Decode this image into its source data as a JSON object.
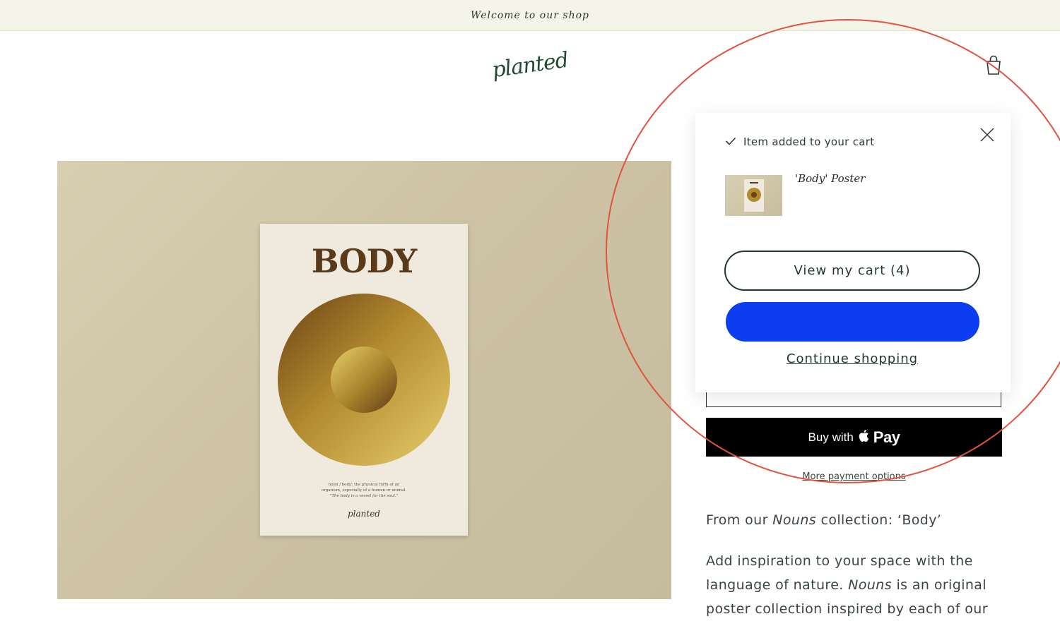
{
  "announcement": {
    "text": "Welcome to our shop"
  },
  "header": {
    "logo_text": "planted",
    "cart_icon": "shopping-bag-icon"
  },
  "product": {
    "poster_title": "BODY",
    "poster_definition_line1": "noun /ˈbodi/: the physical form of an",
    "poster_definition_line2": "organism, especially of a human or animal.",
    "poster_quote": "\"The body is a vessel for the soul.\"",
    "poster_signature": "planted",
    "buy_with_label": "Buy with",
    "apple_pay_label": "Pay",
    "more_payment_options": "More payment options",
    "description_line": {
      "prefix": "From our ",
      "em": "Nouns",
      "suffix": " collection: ‘Body’"
    },
    "description_para": {
      "prefix": "Add inspiration to your space with the language of nature. ",
      "em": "Nouns",
      "suffix": " is an original poster collection inspired by each of our"
    }
  },
  "cart_popup": {
    "added_message": "Item added to your cart",
    "item_name": "'Body' Poster",
    "view_cart_label": "View my cart (4)",
    "continue_label": "Continue shopping"
  },
  "colors": {
    "brand_green": "#1f4a33",
    "pay_button_blue": "#0c3df0",
    "highlight_circle": "#e0533f"
  }
}
